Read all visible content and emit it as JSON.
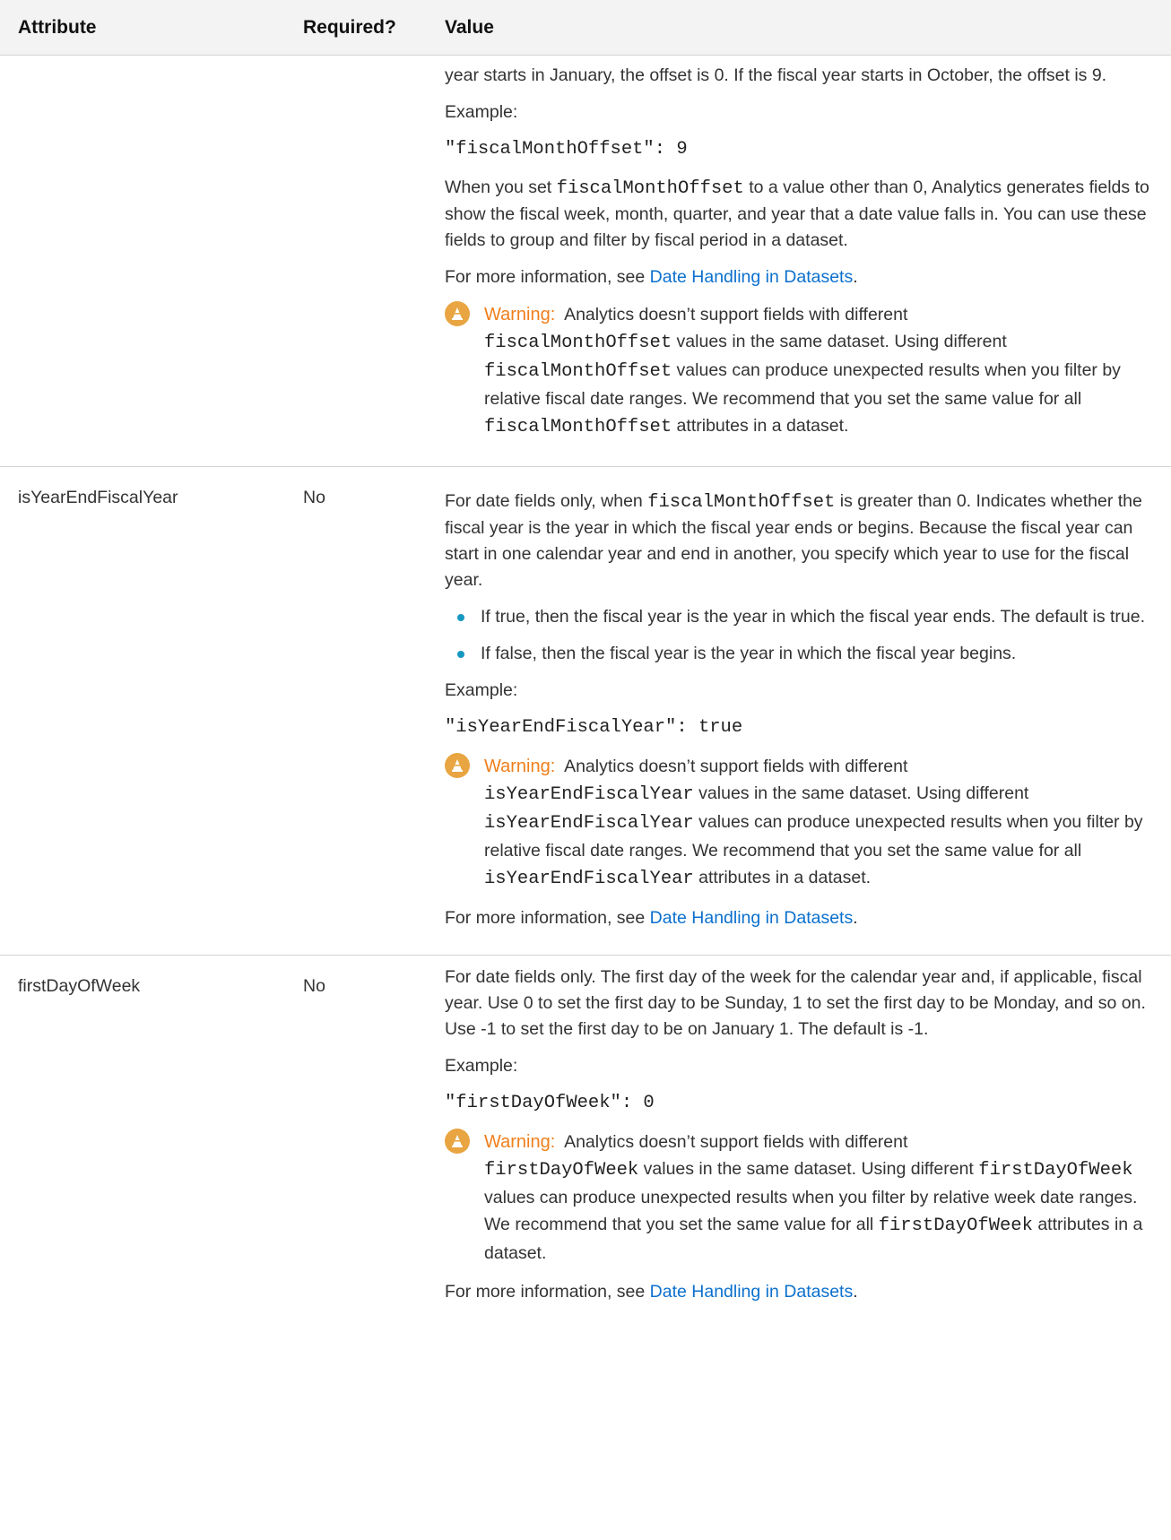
{
  "header": {
    "col_attribute": "Attribute",
    "col_required": "Required?",
    "col_value": "Value"
  },
  "row1": {
    "continuation": "year starts in January, the offset is 0. If the fiscal year starts in October, the offset is 9.",
    "example_label": "Example:",
    "code": "\"fiscalMonthOffset\": 9",
    "desc_before": "When you set ",
    "desc_code": "fiscalMonthOffset",
    "desc_after": " to a value other than 0, Analytics generates fields to show the fiscal week, month, quarter, and year that a date value falls in. You can use these fields to group and filter by fiscal period in a dataset.",
    "more_prefix": "For more information, see ",
    "more_link": "Date Handling in Datasets",
    "more_suffix": ".",
    "warning": {
      "label": "Warning:",
      "t1": "Analytics doesn’t support fields with different",
      "c1": "fiscalMonthOffset",
      "t2": " values in the same dataset. Using different",
      "c2": "fiscalMonthOffset",
      "t3": " values can produce unexpected results when you filter by relative fiscal date ranges. We recommend that you set the same value for all ",
      "c3": "fiscalMonthOffset",
      "t4": " attributes in a dataset."
    }
  },
  "row2": {
    "attribute": "isYearEndFiscalYear",
    "required": "No",
    "desc_before": "For date fields only, when ",
    "desc_code": "fiscalMonthOffset",
    "desc_after": " is greater than 0. Indicates whether the fiscal year is the year in which the fiscal year ends or begins. Because the fiscal year can start in one calendar year and end in another, you specify which year to use for the fiscal year.",
    "bullets": [
      "If true, then the fiscal year is the year in which the fiscal year ends. The default is true.",
      "If false, then the fiscal year is the year in which the fiscal year begins."
    ],
    "example_label": "Example:",
    "code": "\"isYearEndFiscalYear\": true",
    "warning": {
      "label": "Warning:",
      "t1": "Analytics doesn’t support fields with different",
      "c1": "isYearEndFiscalYear",
      "t2": " values in the same dataset. Using different",
      "c2": "isYearEndFiscalYear",
      "t3": " values can produce unexpected results when you filter by relative fiscal date ranges. We recommend that you set the same value for all ",
      "c3": "isYearEndFiscalYear",
      "t4": " attributes in a dataset."
    },
    "more_prefix": "For more information, see ",
    "more_link": "Date Handling in Datasets",
    "more_suffix": "."
  },
  "row3": {
    "attribute": "firstDayOfWeek",
    "required": "No",
    "desc": "For date fields only. The first day of the week for the calendar year and, if applicable, fiscal year. Use 0 to set the first day to be Sunday, 1 to set the first day to be Monday, and so on. Use -1 to set the first day to be on January 1. The default is -1.",
    "example_label": "Example:",
    "code": "\"firstDayOfWeek\": 0",
    "warning": {
      "label": "Warning:",
      "t1": "Analytics doesn’t support fields with different",
      "c1": "firstDayOfWeek",
      "t2": " values in the same dataset. Using different",
      "c2": "firstDayOfWeek",
      "t3": " values can produce unexpected results when you filter by relative week date ranges. We recommend that you set the same value for all ",
      "c3": "firstDayOfWeek",
      "t4": " attributes in a dataset."
    },
    "more_prefix": "For more information, see ",
    "more_link": "Date Handling in Datasets",
    "more_suffix": "."
  },
  "icons": {
    "warning": "warning-cone-icon",
    "bullet": "bullet-dot-icon"
  },
  "colors": {
    "link": "#0b70ce",
    "warning_label": "#f07e1a",
    "warning_icon": "#e8a541",
    "bullet": "#1798c1",
    "header_bg": "#f3f3f3"
  }
}
